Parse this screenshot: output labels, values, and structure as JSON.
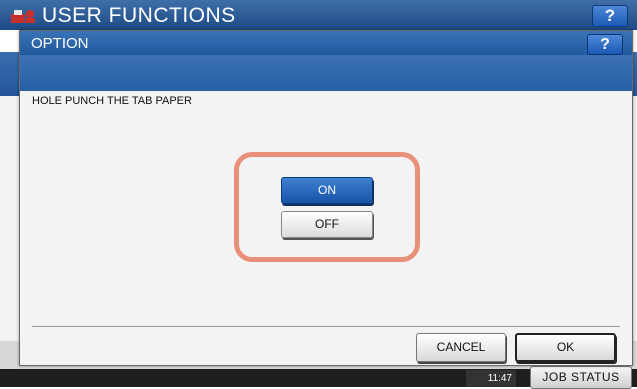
{
  "background": {
    "title": "USER FUNCTIONS",
    "help_label": "?",
    "clock": "11:47",
    "job_status_label": "JOB STATUS"
  },
  "dialog": {
    "title": "OPTION",
    "help_label": "?",
    "setting_label": "HOLE PUNCH THE TAB PAPER",
    "options": [
      {
        "label": "ON",
        "selected": true
      },
      {
        "label": "OFF",
        "selected": false
      }
    ],
    "cancel_label": "CANCEL",
    "ok_label": "OK"
  },
  "colors": {
    "header_blue": "#21599f",
    "selected_button": "#1654a8",
    "highlight_ring": "#e9907a"
  },
  "icons": {
    "logo": "user-functions-logo-icon"
  }
}
